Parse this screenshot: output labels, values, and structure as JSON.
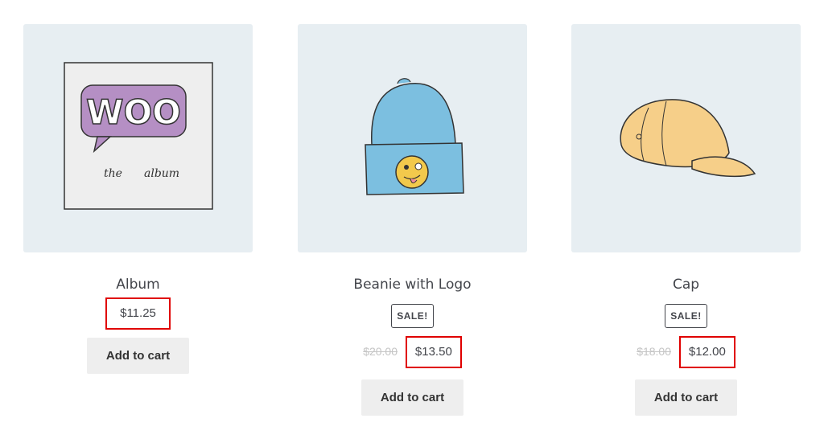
{
  "products": [
    {
      "title": "Album",
      "sale": null,
      "old_price": null,
      "price": "$11.25",
      "button": "Add to cart",
      "image": "album-art-image",
      "album_logo_text": "WOO",
      "album_caption_left": "the",
      "album_caption_right": "album"
    },
    {
      "title": "Beanie with Logo",
      "sale": "SALE!",
      "old_price": "$20.00",
      "price": "$13.50",
      "button": "Add to cart",
      "image": "beanie-image"
    },
    {
      "title": "Cap",
      "sale": "SALE!",
      "old_price": "$18.00",
      "price": "$12.00",
      "button": "Add to cart",
      "image": "cap-image"
    }
  ],
  "colors": {
    "thumb_bg": "#e7eef2",
    "highlight": "#e00000",
    "button_bg": "#eeeeee"
  }
}
